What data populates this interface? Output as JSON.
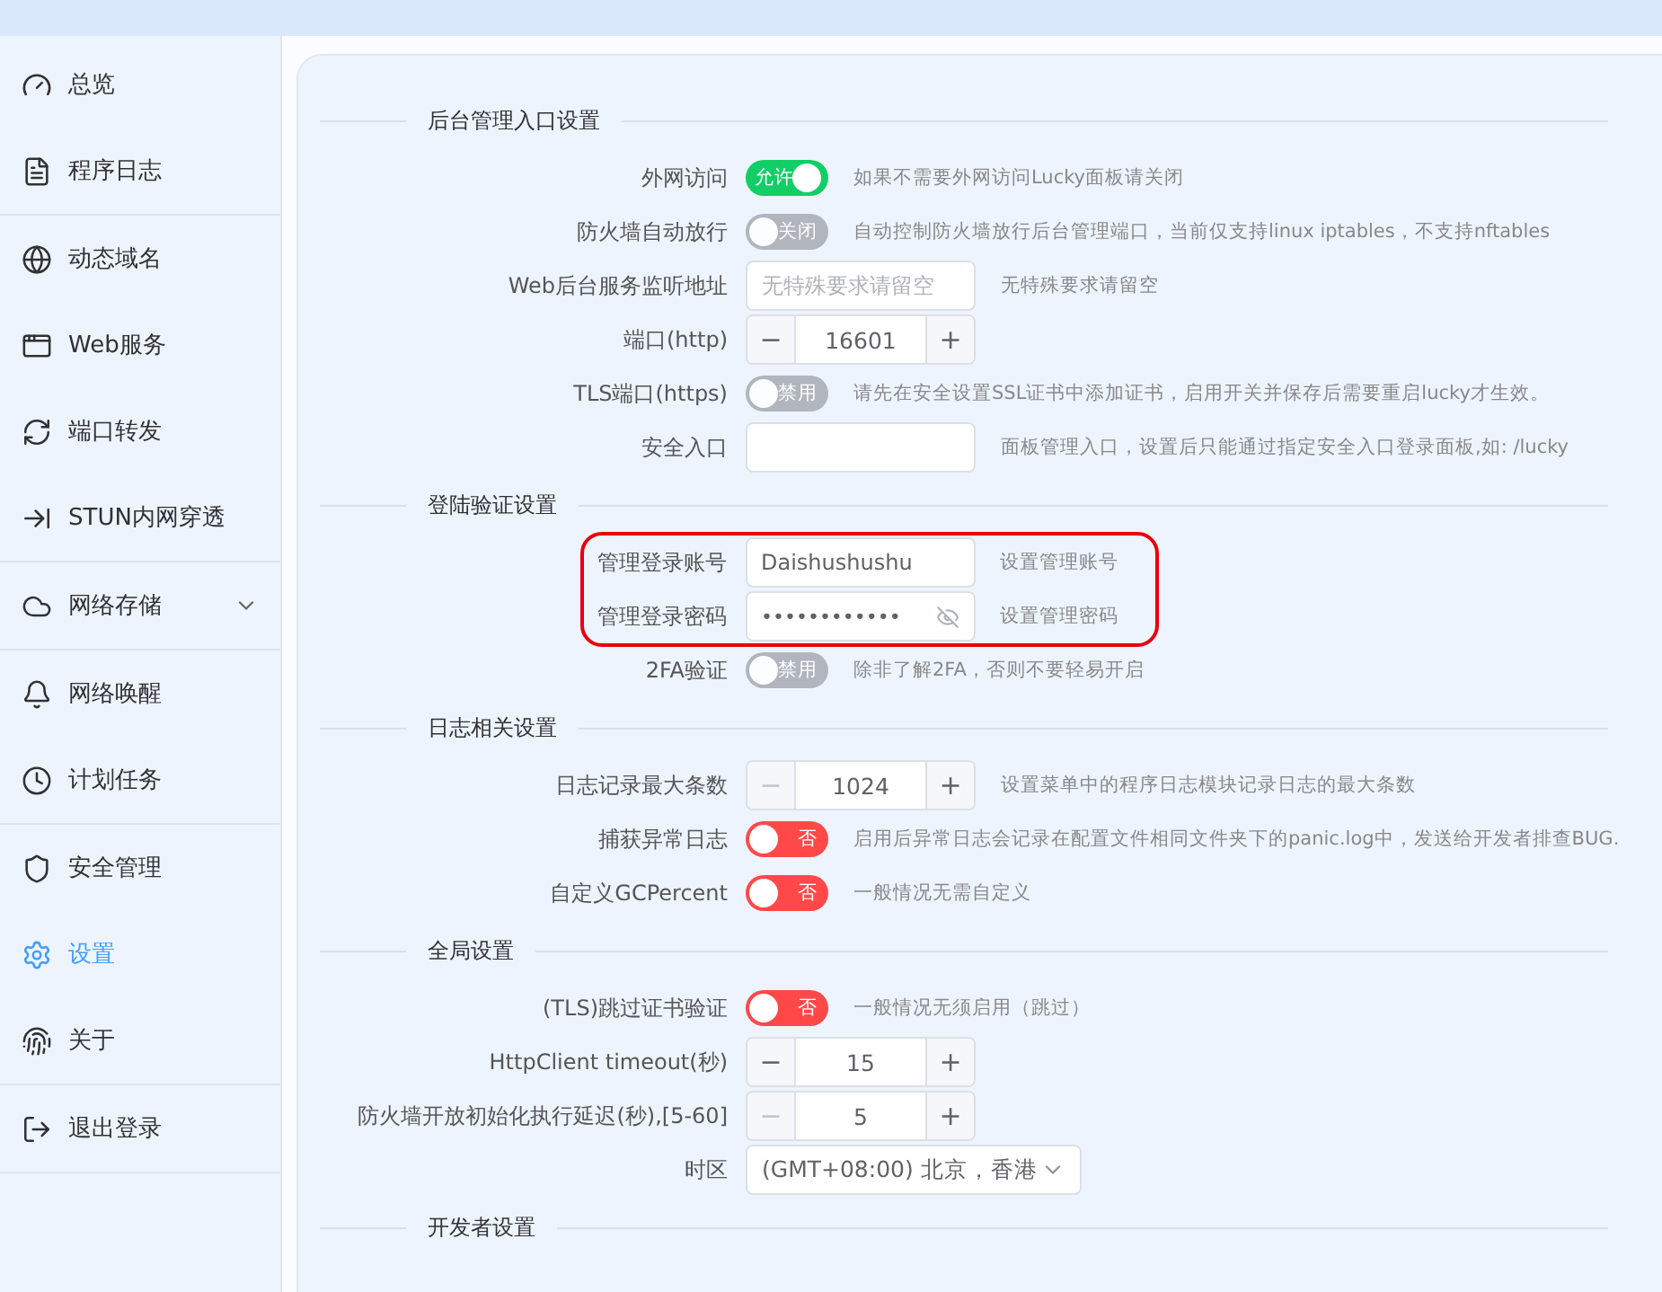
{
  "sidebar": {
    "groups": [
      [
        {
          "label": "总览",
          "selected": false
        },
        {
          "label": "程序日志",
          "selected": false
        }
      ],
      [
        {
          "label": "动态域名",
          "selected": false
        },
        {
          "label": "Web服务",
          "selected": false
        },
        {
          "label": "端口转发",
          "selected": false
        },
        {
          "label": "STUN内网穿透",
          "selected": false
        }
      ],
      [
        {
          "label": "网络存储",
          "selected": false,
          "expanded": false
        }
      ],
      [
        {
          "label": "网络唤醒",
          "selected": false
        },
        {
          "label": "计划任务",
          "selected": false
        }
      ],
      [
        {
          "label": "安全管理",
          "selected": false
        },
        {
          "label": "设置",
          "selected": true
        },
        {
          "label": "关于",
          "selected": false
        }
      ],
      [
        {
          "label": "退出登录",
          "selected": false
        }
      ]
    ]
  },
  "sections": [
    {
      "title": "后台管理入口设置",
      "rows": [
        {
          "label": "外网访问",
          "kind": "switch",
          "on": true,
          "disabled": false,
          "text": "允许",
          "hint": "如果不需要外网访问Lucky面板请关闭"
        },
        {
          "label": "防火墙自动放行",
          "kind": "switch",
          "on": false,
          "disabled": true,
          "text": "关闭",
          "hint": "自动控制防火墙放行后台管理端口，当前仅支持linux iptables，不支持nftables"
        },
        {
          "label": "Web后台服务监听地址",
          "kind": "text",
          "placeholder": "无特殊要求请留空",
          "hint": "无特殊要求请留空"
        },
        {
          "label": "端口(http)",
          "kind": "number",
          "value": "16601",
          "minus_disabled": false,
          "minus": "−",
          "plus": "+"
        },
        {
          "label": "TLS端口(https)",
          "kind": "switch",
          "on": false,
          "disabled": true,
          "text": "禁用",
          "hint": "请先在安全设置SSL证书中添加证书，启用开关并保存后需要重启lucky才生效。"
        },
        {
          "label": "安全入口",
          "kind": "text",
          "hint": "面板管理入口，设置后只能通过指定安全入口登录面板,如: /lucky"
        }
      ]
    },
    {
      "title": "登陆验证设置",
      "rows": [
        {
          "label": "管理登录账号",
          "kind": "text",
          "value": "Daishushushu",
          "hint": "设置管理账号",
          "highlighted": true
        },
        {
          "label": "管理登录密码",
          "kind": "password",
          "value": "••••••••••••",
          "hint": "设置管理密码",
          "highlighted": true
        },
        {
          "label": "2FA验证",
          "kind": "switch",
          "on": false,
          "disabled": true,
          "text": "禁用",
          "hint": "除非了解2FA，否则不要轻易开启"
        }
      ]
    },
    {
      "title": "日志相关设置",
      "rows": [
        {
          "label": "日志记录最大条数",
          "kind": "number",
          "value": "1024",
          "minus_disabled": true,
          "minus": "−",
          "plus": "+",
          "hint": "设置菜单中的程序日志模块记录日志的最大条数"
        },
        {
          "label": "捕获异常日志",
          "kind": "switch",
          "on": false,
          "disabled": false,
          "text": "否",
          "hint": "启用后异常日志会记录在配置文件相同文件夹下的panic.log中，发送给开发者排查BUG."
        },
        {
          "label": "自定义GCPercent",
          "kind": "switch",
          "on": false,
          "disabled": false,
          "text": "否",
          "hint": "一般情况无需自定义"
        }
      ]
    },
    {
      "title": "全局设置",
      "rows": [
        {
          "label": "(TLS)跳过证书验证",
          "kind": "switch",
          "on": false,
          "disabled": false,
          "text": "否",
          "hint": "一般情况无须启用（跳过）"
        },
        {
          "label": "HttpClient timeout(秒)",
          "kind": "number",
          "value": "15",
          "minus_disabled": false,
          "minus": "−",
          "plus": "+"
        },
        {
          "label": "防火墙开放初始化执行延迟(秒),[5-60]",
          "kind": "number",
          "value": "5",
          "minus_disabled": true,
          "minus": "−",
          "plus": "+"
        },
        {
          "label": "时区",
          "kind": "select",
          "value": "(GMT+08:00) 北京，香港"
        }
      ]
    },
    {
      "title": "开发者设置"
    }
  ]
}
